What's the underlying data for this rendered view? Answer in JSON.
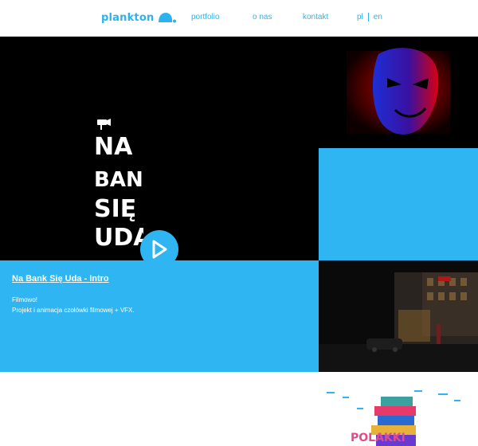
{
  "nav": {
    "logo_text": "plankton",
    "links": [
      "portfolio",
      "o nas",
      "kontakt"
    ],
    "lang": [
      "pl",
      "en"
    ]
  },
  "hero": {
    "title_art_lines": [
      "NA",
      "BANK",
      "SIĘ",
      "UDA"
    ]
  },
  "project": {
    "title": "Na Bank Się Uda - Intro",
    "line1": "Filmowo!",
    "line2": "Projekt i animacja czołówki filmowej + VFX."
  },
  "books_tile": {
    "art_text": "POLAKKI"
  },
  "colors": {
    "accent": "#2fb5f2",
    "hero_bg": "#000000"
  }
}
